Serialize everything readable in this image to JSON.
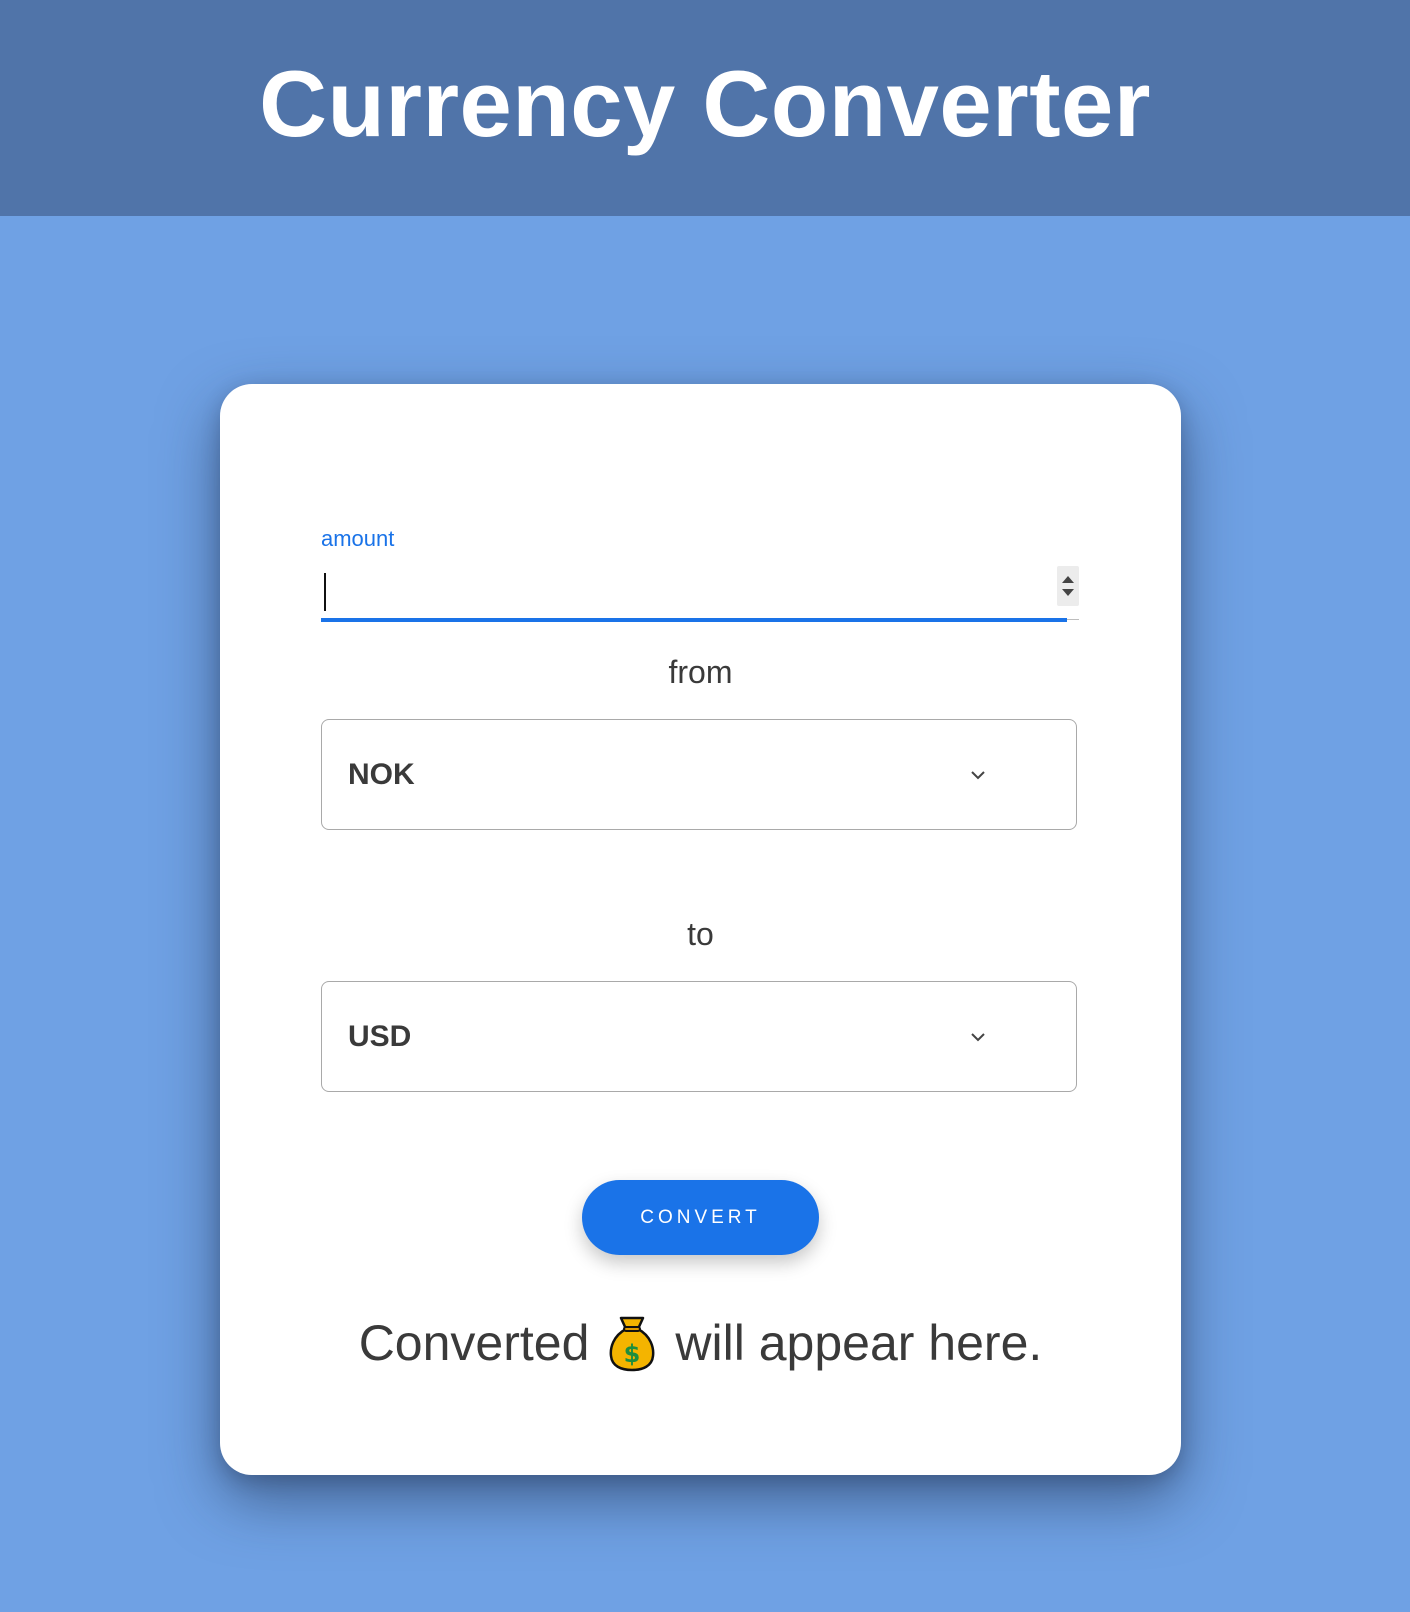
{
  "header": {
    "title": "Currency Converter"
  },
  "form": {
    "amount_label": "amount",
    "amount_value": "",
    "from_caption": "from",
    "from_currency": "NOK",
    "to_caption": "to",
    "to_currency": "USD",
    "convert_label": "CONVERT"
  },
  "result": {
    "prefix": "Converted",
    "icon": "money-bag-icon",
    "suffix": "will appear here."
  },
  "colors": {
    "header_bg": "#5074a9",
    "page_bg": "#6fa1e4",
    "accent": "#1a73e8",
    "card_bg": "#ffffff"
  }
}
